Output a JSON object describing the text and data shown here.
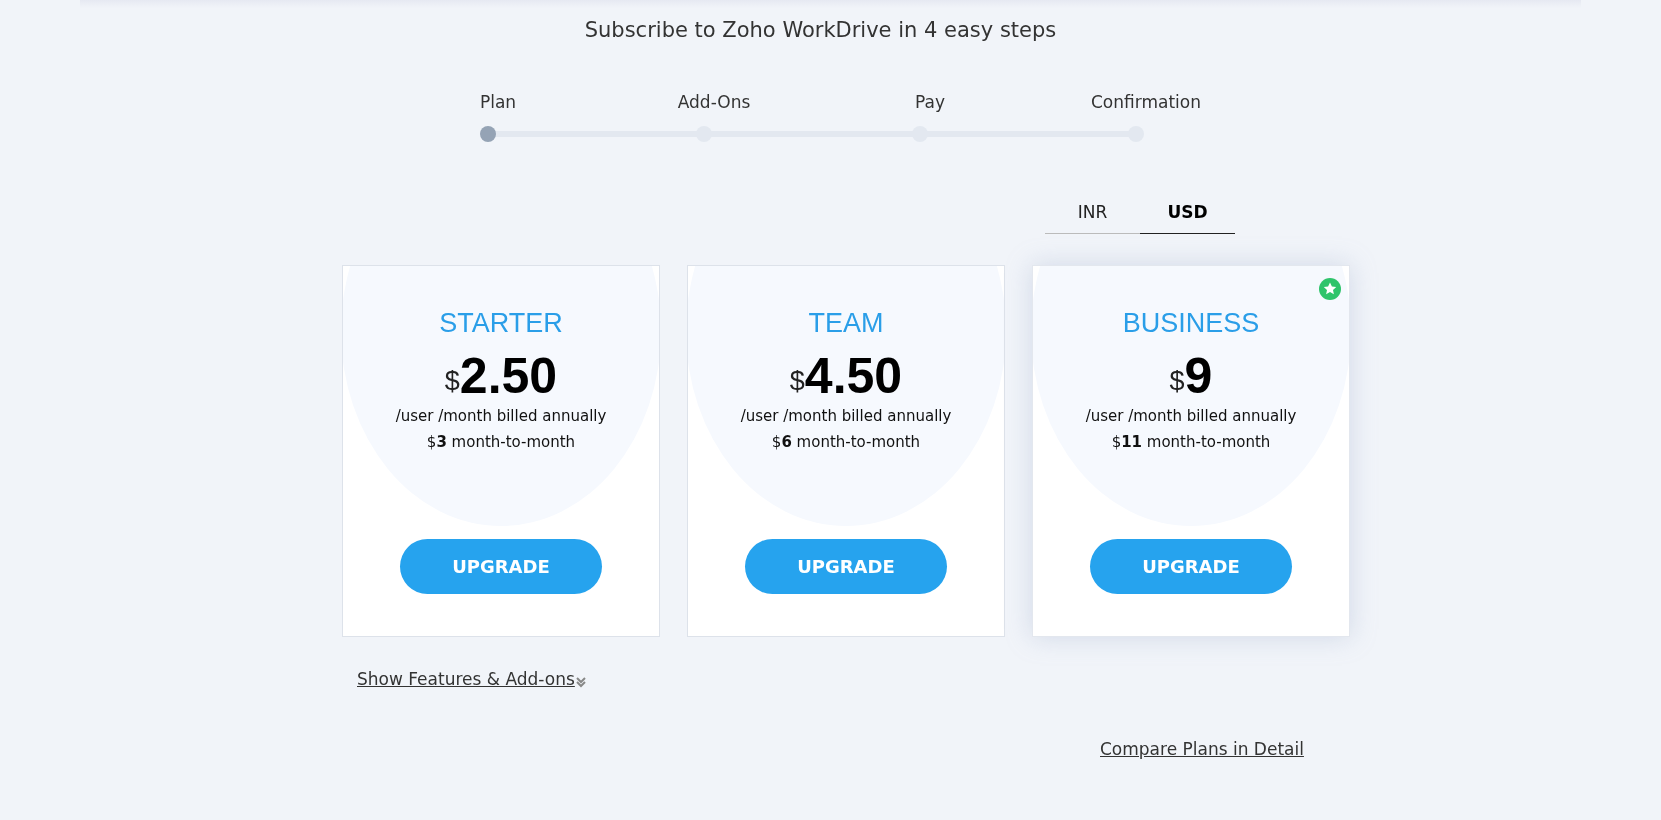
{
  "heading": "Subscribe to Zoho WorkDrive in 4 easy steps",
  "steps": [
    {
      "label": "Plan",
      "selected": true
    },
    {
      "label": "Add-Ons",
      "selected": false
    },
    {
      "label": "Pay",
      "selected": false
    },
    {
      "label": "Confirmation",
      "selected": false
    }
  ],
  "currency_tabs": [
    {
      "label": "INR",
      "selected": false
    },
    {
      "label": "USD",
      "selected": true
    }
  ],
  "plans": [
    {
      "name": "STARTER",
      "currency": "$",
      "amount": "2.50",
      "billing": "/user /month billed annually",
      "monthly": "$**3** month-to-month",
      "button": "UPGRADE",
      "featured": false
    },
    {
      "name": "TEAM",
      "currency": "$",
      "amount": "4.50",
      "billing": "/user /month billed annually",
      "monthly": "$**6** month-to-month",
      "button": "UPGRADE",
      "featured": false
    },
    {
      "name": "BUSINESS",
      "currency": "$",
      "amount": "9",
      "billing": "/user /month billed annually",
      "monthly": "$**11** month-to-month",
      "button": "UPGRADE",
      "featured": true
    }
  ],
  "show_features_link": "Show Features & Add-ons",
  "compare_link": "Compare Plans in Detail"
}
